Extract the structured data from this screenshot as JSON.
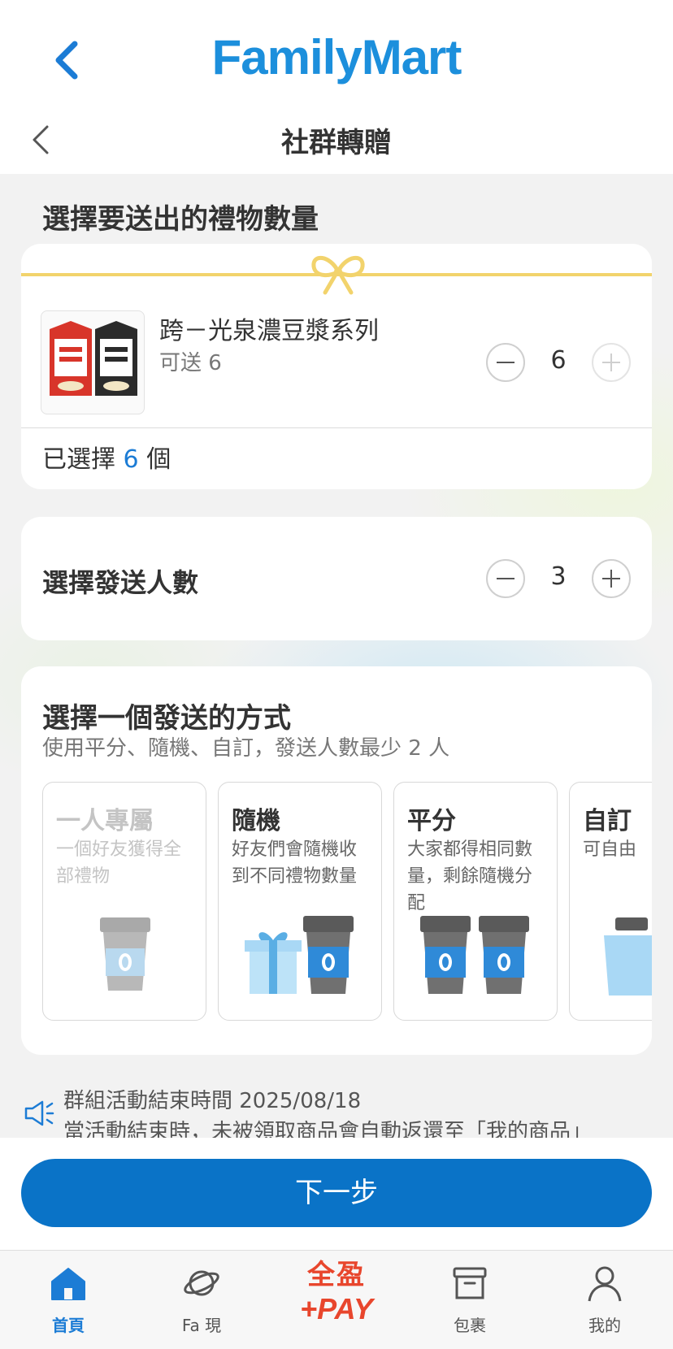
{
  "brand": {
    "logo": "FamilyMart"
  },
  "header": {
    "title": "社群轉贈"
  },
  "gift_section": {
    "heading": "選擇要送出的禮物數量",
    "product_name": "跨－光泉濃豆漿系列",
    "available": "可送 6",
    "quantity": "6",
    "selected_prefix": "已選擇",
    "selected_count": "6",
    "selected_suffix": "個"
  },
  "recipients": {
    "label": "選擇發送人數",
    "count": "3"
  },
  "method": {
    "title": "選擇一個發送的方式",
    "subtitle": "使用平分、隨機、自訂，發送人數最少 2 人",
    "options": [
      {
        "title": "一人專屬",
        "desc": "一個好友獲得全部禮物",
        "enabled": false
      },
      {
        "title": "隨機",
        "desc": "好友們會隨機收到不同禮物數量",
        "enabled": true
      },
      {
        "title": "平分",
        "desc": "大家都得相同數量，剩餘隨機分配",
        "enabled": true
      },
      {
        "title": "自訂",
        "desc": "可自由",
        "enabled": true
      }
    ]
  },
  "notice": {
    "line1": "群組活動結束時間 2025/08/18",
    "line2": "當活動結束時，未被領取商品會自動返還至「我的商品」"
  },
  "next_button": "下一步",
  "tab_bar": {
    "items": [
      {
        "label": "首頁",
        "icon": "home-icon",
        "active": true
      },
      {
        "label": "Fa 現",
        "icon": "planet-icon",
        "active": false
      },
      {
        "label_top": "全盈",
        "label_bottom": "+PAY",
        "icon": "pay-logo",
        "active": false
      },
      {
        "label": "包裹",
        "icon": "box-icon",
        "active": false
      },
      {
        "label": "我的",
        "icon": "person-icon",
        "active": false
      }
    ]
  },
  "colors": {
    "brand_blue": "#1c8fdc",
    "button_blue": "#0a73c7",
    "ribbon": "#f2d36c",
    "pay_red": "#e8462d"
  }
}
